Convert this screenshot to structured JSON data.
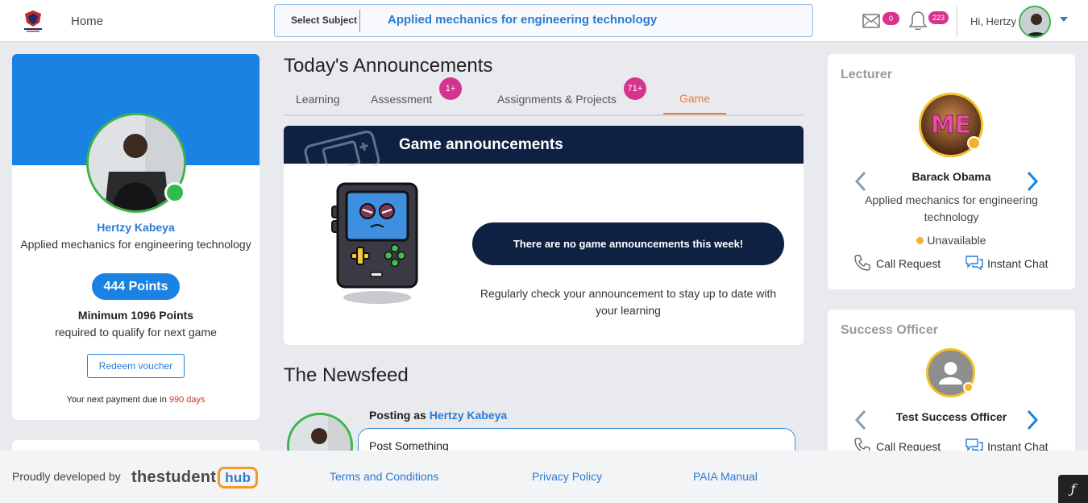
{
  "topbar": {
    "home": "Home",
    "subject_label": "Select Subject",
    "subject_value": "Applied mechanics for engineering technology",
    "mail_count": "0",
    "notification_count": "223",
    "greeting": "Hi, Hertzy"
  },
  "profile": {
    "name": "Hertzy Kabeya",
    "course": "Applied mechanics for engineering technology",
    "points": "444 Points",
    "min_points": "Minimum 1096 Points",
    "qualify_text": "required to qualify for next game",
    "redeem_label": "Redeem voucher",
    "payment_prefix": "Your next payment due in ",
    "payment_days": "990 days"
  },
  "announcements": {
    "title": "Today's Announcements",
    "tabs": [
      {
        "label": "Learning",
        "badge": ""
      },
      {
        "label": "Assessment",
        "badge": "1+"
      },
      {
        "label": "Assignments & Projects",
        "badge": "71+"
      },
      {
        "label": "Game",
        "badge": ""
      }
    ],
    "active_tab": "Game",
    "game_card": {
      "title": "Game announcements",
      "empty_message": "There are no game announcements this week!",
      "hint": "Regularly check your announcement to stay up to date with your learning"
    }
  },
  "newsfeed": {
    "title": "The Newsfeed",
    "posting_as_label": "Posting as",
    "posting_as_name": "Hertzy Kabeya",
    "post_placeholder": "Post Something"
  },
  "lecturer": {
    "heading": "Lecturer",
    "avatar_text": "ME",
    "name": "Barack Obama",
    "course": "Applied mechanics for engineering technology",
    "status": "Unavailable",
    "call_label": "Call Request",
    "chat_label": "Instant Chat"
  },
  "success_officer": {
    "heading": "Success Officer",
    "name": "Test Success Officer",
    "call_label": "Call Request",
    "chat_label": "Instant Chat"
  },
  "footer": {
    "developed_by": "Proudly developed by",
    "brand_text": "thestudent",
    "brand_badge": "hub",
    "links": [
      "Terms and Conditions",
      "Privacy Policy",
      "PAIA Manual"
    ]
  },
  "colors": {
    "primary_blue": "#1a82e2",
    "navy": "#0e2142",
    "badge_pink": "#d6338f",
    "online_green": "#2ebd4e",
    "away_yellow": "#f4b42a",
    "active_tab_orange": "#ec7b3b"
  }
}
